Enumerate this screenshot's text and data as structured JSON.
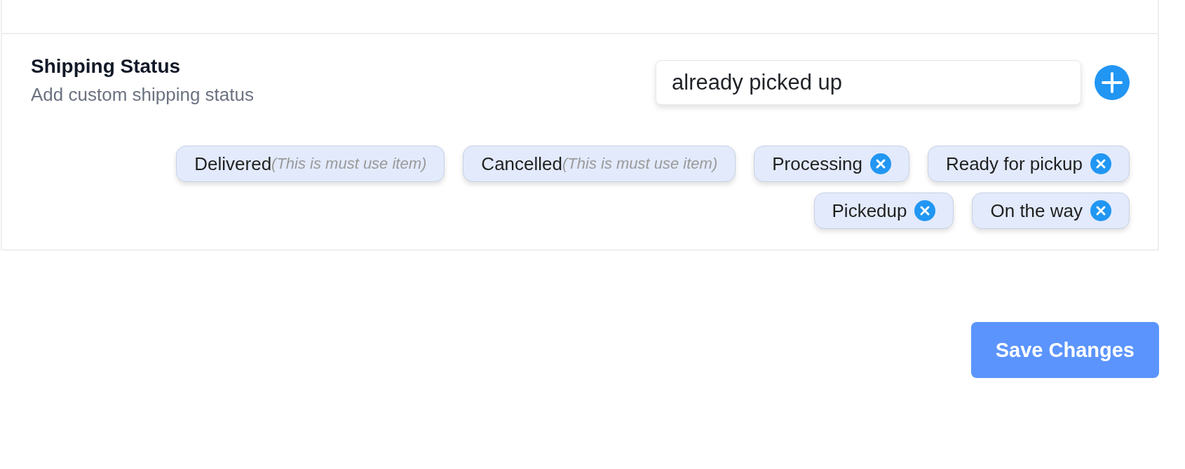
{
  "shipping_status": {
    "title": "Shipping Status",
    "subtitle": "Add custom shipping status",
    "input": {
      "value": "already picked up"
    },
    "tags": [
      {
        "label": "Delivered",
        "note": "(This is must use item)",
        "removable": false
      },
      {
        "label": "Cancelled",
        "note": "(This is must use item)",
        "removable": false
      },
      {
        "label": "Processing",
        "removable": true
      },
      {
        "label": "Ready for pickup",
        "removable": true
      },
      {
        "label": "Pickedup",
        "removable": true
      },
      {
        "label": "On the way",
        "removable": true
      }
    ]
  },
  "save_button": {
    "label": "Save Changes"
  }
}
